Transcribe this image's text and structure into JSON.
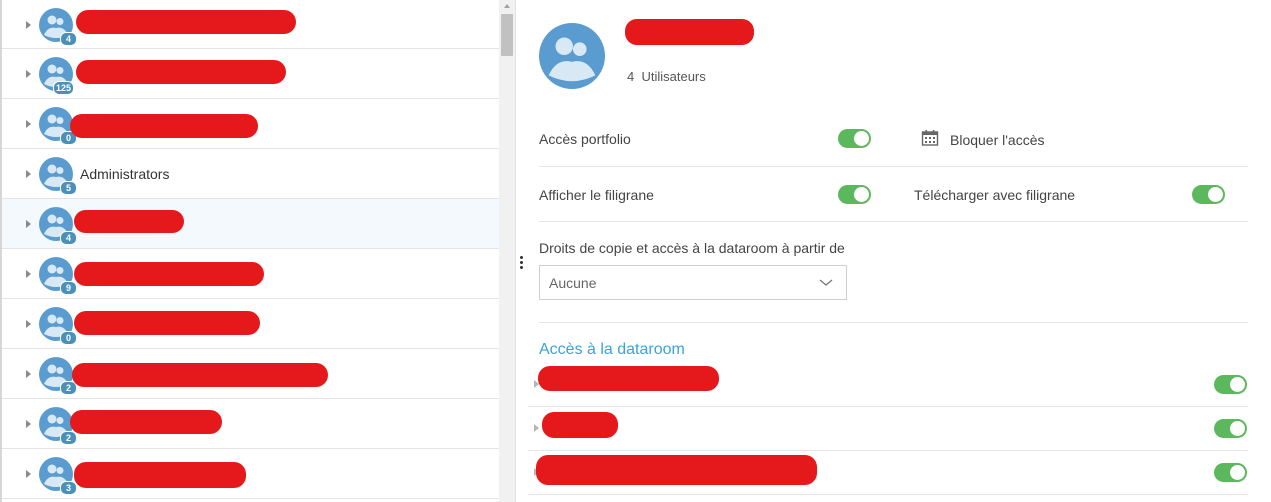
{
  "groups": [
    {
      "name": "",
      "count": "4"
    },
    {
      "name": "",
      "count": "125"
    },
    {
      "name": "",
      "count": "0"
    },
    {
      "name": "Administrators",
      "count": "5"
    },
    {
      "name": "",
      "count": "4"
    },
    {
      "name": "",
      "count": "9"
    },
    {
      "name": "",
      "count": "0"
    },
    {
      "name": "",
      "count": "2"
    },
    {
      "name": "",
      "count": "2"
    },
    {
      "name": "",
      "count": "3"
    }
  ],
  "detail": {
    "title": "",
    "user_count": "4  Utilisateurs",
    "settings": {
      "portfolio_access": "Accès portfolio",
      "block_access": "Bloquer l'accès",
      "show_watermark": "Afficher le filigrane",
      "download_with_watermark": "Télécharger avec filigrane"
    },
    "copy_rights": {
      "label": "Droits de copie et accès à la dataroom à partir de",
      "selected": "Aucune"
    },
    "dataroom": {
      "title": "Accès à la dataroom",
      "items": [
        {
          "name": "",
          "enabled": true
        },
        {
          "name": "",
          "enabled": true
        },
        {
          "name": "",
          "enabled": true
        }
      ]
    }
  },
  "colors": {
    "accent": "#3aa3d8",
    "toggle_on": "#5cb85c",
    "avatar": "#5a9ccf",
    "badge": "#4a90b8",
    "redaction": "#e5191b"
  }
}
